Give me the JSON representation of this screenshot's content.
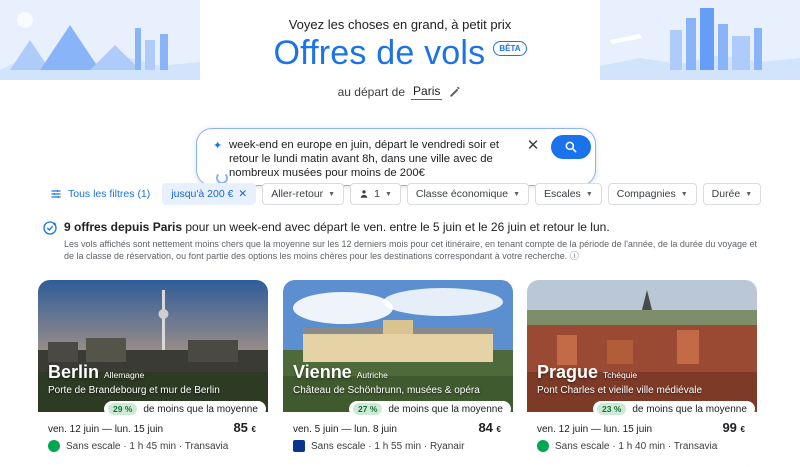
{
  "header": {
    "tagline": "Voyez les choses en grand, à petit prix",
    "title": "Offres de vols",
    "badge": "BÊTA",
    "origin_label": "au départ de",
    "origin_value": "Paris"
  },
  "search": {
    "query": "week-end en europe en juin, départ le vendredi soir et retour le lundi matin avant 8h, dans une ville avec de nombreux musées pour moins de 200€"
  },
  "filters": {
    "all_filters": "Tous les filtres (1)",
    "budget": "jusqu'à 200 €",
    "trip_type": "Aller-retour",
    "passengers": "1",
    "cabin": "Classe économique",
    "stops": "Escales",
    "airlines": "Compagnies",
    "duration": "Durée"
  },
  "results": {
    "title_bold": "9 offres depuis Paris",
    "title_rest": " pour un week-end avec départ le ven. entre le 5 juin et le 26 juin et retour le lun.",
    "description": "Les vols affichés sont nettement moins chers que la moyenne sur les 12 derniers mois pour cet itinéraire, en tenant compte de la période de l'année, de la durée du voyage et de la classe de réservation, ou font partie des options les moins chères pour les destinations correspondant à votre recherche."
  },
  "cards": [
    {
      "city": "Berlin",
      "country": "Allemagne",
      "subtitle": "Porte de Brandebourg et mur de Berlin",
      "pct": "29 %",
      "savings_text": "de moins que la moyenne",
      "dates": "ven. 12 juin — lun. 15 juin",
      "price": "85",
      "currency": "€",
      "stops": "Sans escale · 1 h 45 min · Transavia"
    },
    {
      "city": "Vienne",
      "country": "Autriche",
      "subtitle": "Château de Schönbrunn, musées & opéra",
      "pct": "27 %",
      "savings_text": "de moins que la moyenne",
      "dates": "ven. 5 juin — lun. 8 juin",
      "price": "84",
      "currency": "€",
      "stops": "Sans escale · 1 h 55 min · Ryanair"
    },
    {
      "city": "Prague",
      "country": "Tchéquie",
      "subtitle": "Pont Charles et vieille ville médiévale",
      "pct": "23 %",
      "savings_text": "de moins que la moyenne",
      "dates": "ven. 12 juin — lun. 15 juin",
      "price": "99",
      "currency": "€",
      "stops": "Sans escale · 1 h 40 min · Transavia"
    }
  ],
  "colors": {
    "accent": "#1a73e8",
    "savings_bg": "#ceead6",
    "savings_text": "#137333",
    "transavia": "#00a651",
    "ryanair": "#073590"
  }
}
